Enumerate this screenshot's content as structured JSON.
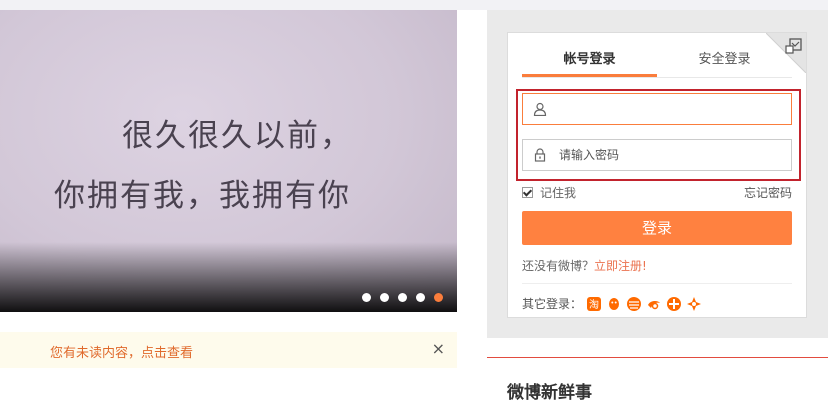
{
  "banner": {
    "line1": "很久很久以前，",
    "line2": "你拥有我，我拥有你",
    "dots": 5,
    "active_index": 4
  },
  "notice": {
    "text": "您有未读内容，点击查看",
    "close": "×"
  },
  "login": {
    "tabs": [
      "帐号登录",
      "安全登录"
    ],
    "username_placeholder": "",
    "password_placeholder": "请输入密码",
    "remember_label": "记住我",
    "forgot_label": "忘记密码",
    "login_button": "登录",
    "register_prompt": "还没有微博？",
    "register_link": "立即注册!",
    "other_login_label": "其它登录：",
    "other_icons": [
      "taobao-icon",
      "qq-icon",
      "ppstv-icon",
      "tianyi-icon",
      "unicom-icon",
      "cross-icon"
    ]
  },
  "section": {
    "title": "微博新鲜事"
  },
  "colors": {
    "accent": "#fa7d3c",
    "highlight_box": "#c2232d"
  }
}
